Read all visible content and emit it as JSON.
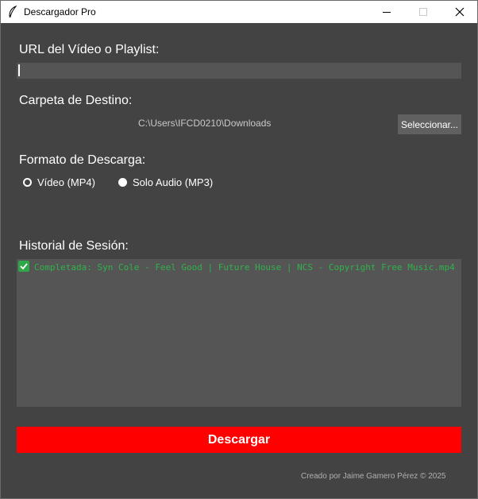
{
  "window": {
    "title": "Descargador Pro",
    "icon": "feather-icon",
    "controls": [
      "minimize-icon",
      "maximize-icon",
      "close-icon"
    ]
  },
  "url_section": {
    "label": "URL del Vídeo o Playlist:",
    "value": ""
  },
  "folder_section": {
    "label": "Carpeta de Destino:",
    "path": "C:\\Users\\IFCD0210\\Downloads",
    "select_button": "Seleccionar..."
  },
  "format_section": {
    "label": "Formato de Descarga:",
    "options": [
      {
        "label": "Vídeo (MP4)",
        "selected": true
      },
      {
        "label": "Solo Audio (MP3)",
        "selected": false
      }
    ]
  },
  "history_section": {
    "label": "Historial de Sesión:",
    "entries": [
      {
        "icon": "check-icon",
        "text": "Completada: Syn Cole - Feel Good | Future House | NCS - Copyright Free Music.mp4"
      }
    ]
  },
  "download_button": "Descargar",
  "footer": "Creado por Jaime Gamero Pérez © 2025",
  "colors": {
    "background": "#434343",
    "input": "#555555",
    "accent": "#ff0000",
    "success": "#2fb34a"
  }
}
